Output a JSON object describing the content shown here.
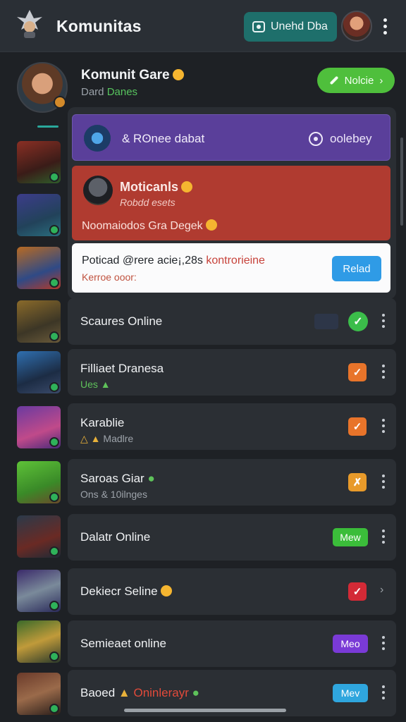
{
  "header": {
    "title": "Komunitas",
    "action_button": "Unehd Dba"
  },
  "community": {
    "title": "Komunit Gare",
    "subtitle_prefix": "Dard",
    "subtitle_accent": "Danes",
    "action_button": "Nolcie"
  },
  "cards": {
    "purple": {
      "label": "& Rʘnee dabat",
      "right": "oolebey"
    },
    "red": {
      "title": "Moticanls",
      "subtitle": "Robdd esets",
      "body": "Noomaiodos Gra Degek"
    },
    "white": {
      "line1_a": "Poticad",
      "line1_b": "@rere acie¡,28s",
      "line1_hl": "kontrorieine",
      "line2": "Kerroe ooor:",
      "button": "Relad"
    }
  },
  "rows": [
    {
      "title": "Scaures Online",
      "sub": "",
      "indicator": "check-circle"
    },
    {
      "title": "Filliaet Dranesa",
      "sub": "Ues",
      "indicator": "check-orange"
    },
    {
      "title": "Karablie",
      "sub": "Madlre",
      "indicator": "check-orange"
    },
    {
      "title": "Saroas Giar",
      "sub": "Ons & 10ilnges",
      "indicator": "check-orange-alt"
    },
    {
      "title": "Dalatr Online",
      "sub": "",
      "indicator": "pill",
      "pill": "Mew"
    },
    {
      "title": "Dekiecr Seline",
      "sub": "",
      "indicator": "check-red"
    },
    {
      "title": "Semieaet online",
      "sub": "",
      "indicator": "pill",
      "pill": "Meo"
    },
    {
      "title": "Baoed",
      "title_hl": "Oninlerayr",
      "sub": "",
      "indicator": "pill",
      "pill": "Mev"
    }
  ],
  "colors": {
    "accent_green": "#4fbf3c",
    "purple": "#5a3f9a",
    "red": "#b03b30",
    "blue": "#2f9be6",
    "orange": "#e8742a",
    "status_green": "#3bbd4a"
  }
}
